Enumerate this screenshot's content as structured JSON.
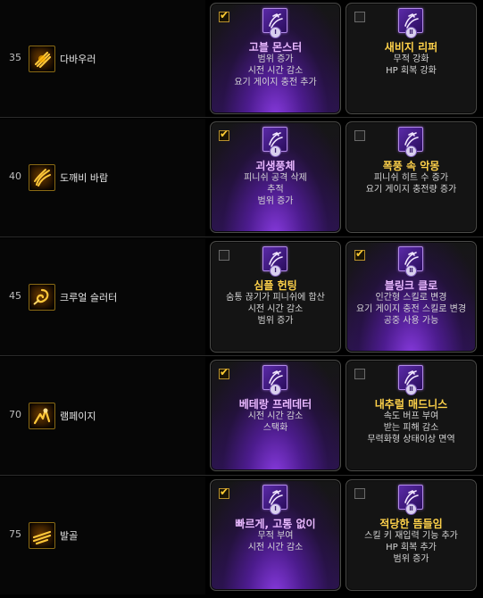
{
  "rows": [
    {
      "level": "35",
      "skill_icon": "claw-slash-icon",
      "skill_name": "다바우러",
      "options": [
        {
          "checked": true,
          "numeral": "Ⅰ",
          "icon": "purple-rune-icon",
          "title": "고블 몬스터",
          "effects": [
            "범위 증가",
            "시전 시간 감소",
            "요기 게이지 충전 추가"
          ]
        },
        {
          "checked": false,
          "numeral": "Ⅱ",
          "icon": "purple-rune-icon",
          "title": "새비지 리퍼",
          "effects": [
            "무적 강화",
            "HP 회복 강화"
          ]
        }
      ]
    },
    {
      "level": "40",
      "skill_icon": "wind-claw-icon",
      "skill_name": "도깨비 바람",
      "options": [
        {
          "checked": true,
          "numeral": "Ⅰ",
          "icon": "purple-rune-icon",
          "title": "괴생풍체",
          "effects": [
            "피니쉬 공격 삭제",
            "추적",
            "범위 증가"
          ]
        },
        {
          "checked": false,
          "numeral": "Ⅱ",
          "icon": "purple-rune-icon",
          "title": "폭풍 속 악몽",
          "effects": [
            "피니쉬 히트 수 증가",
            "요기 게이지 충전량 증가"
          ]
        }
      ]
    },
    {
      "level": "45",
      "skill_icon": "spiral-slash-icon",
      "skill_name": "크루얼 슬러터",
      "options": [
        {
          "checked": false,
          "numeral": "Ⅰ",
          "icon": "purple-rune-icon",
          "title": "심플 헌팅",
          "effects": [
            "숨통 끊기가 피니쉬에 합산",
            "시전 시간 감소",
            "범위 증가"
          ]
        },
        {
          "checked": true,
          "numeral": "Ⅱ",
          "icon": "purple-rune-icon",
          "title": "블링크 클로",
          "effects": [
            "인간형 스킬로 변경",
            "요기 게이지 충전 스킬로 변경",
            "공중 사용 가능"
          ]
        }
      ]
    },
    {
      "level": "70",
      "skill_icon": "rampage-icon",
      "skill_name": "램페이지",
      "options": [
        {
          "checked": true,
          "numeral": "Ⅰ",
          "icon": "purple-rune-icon",
          "title": "베테랑 프레데터",
          "effects": [
            "시전 시간 감소",
            "스택화"
          ]
        },
        {
          "checked": false,
          "numeral": "Ⅱ",
          "icon": "purple-rune-icon",
          "title": "내추럴 매드니스",
          "effects": [
            "속도 버프 부여",
            "받는 피해 감소",
            "무력화형 상태이상 면역"
          ]
        }
      ]
    },
    {
      "level": "75",
      "skill_icon": "dash-claw-icon",
      "skill_name": "발골",
      "options": [
        {
          "checked": true,
          "numeral": "Ⅰ",
          "icon": "purple-rune-icon",
          "title": "빠르게, 고통 없이",
          "effects": [
            "무적 부여",
            "시전 시간 감소"
          ]
        },
        {
          "checked": false,
          "numeral": "Ⅱ",
          "icon": "purple-rune-icon",
          "title": "적당한 뜸들임",
          "effects": [
            "스킬 키 재입력 기능 추가",
            "HP 회복 추가",
            "범위 증가"
          ]
        }
      ]
    }
  ],
  "check_glyph": "✔"
}
